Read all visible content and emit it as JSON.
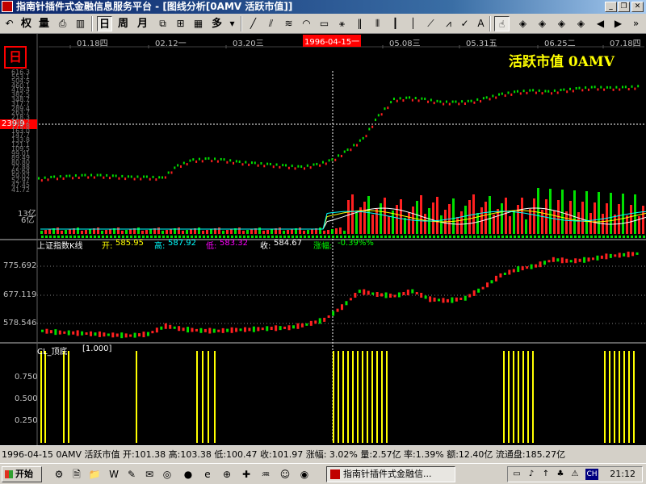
{
  "window": {
    "title": "指南针插件式金融信息服务平台 - [图线分析[0AMV 活跃市值]]",
    "minimize": "_",
    "restore": "❐",
    "close": "✕"
  },
  "toolbar": {
    "day_label": "日",
    "week_label": "周",
    "month_label": "月",
    "multi_label": "多",
    "quan_label": "权",
    "liang_label": "量"
  },
  "chart": {
    "date_labels": [
      "01.18四",
      "02.12一",
      "03.20三",
      "05.08三",
      "05.31五",
      "06.25二",
      "07.18四"
    ],
    "cursor_date": "1996-04-15一",
    "logo_glyph": "日",
    "big_title": "活跃市值 0AMV",
    "current_price": "239.9",
    "price_axis": [
      "616.3",
      "553.1",
      "504.5",
      "460.1",
      "419.4",
      "382.5",
      "348.7",
      "317.7",
      "289.4",
      "263.7",
      "218.3",
      "198.2",
      "179.8",
      "163.0",
      "147.7",
      "133.8",
      "121.1",
      "109.5",
      "99.01",
      "89.49",
      "80.80",
      "72.88",
      "65.64",
      "59.02",
      "52.97",
      "47.45",
      "41.72"
    ],
    "volume_axis": [
      "13亿",
      "6亿"
    ],
    "index_panel": {
      "name": "上证指数K线",
      "open_label": "开:",
      "open": "585.95",
      "high_label": "高:",
      "high": "587.92",
      "low_label": "低:",
      "low": "583.32",
      "close_label": "收:",
      "close": "584.67",
      "change_label": "涨幅:",
      "change": "-0.39%%",
      "axis": [
        "775.692",
        "677.119",
        "578.546"
      ]
    },
    "indicator_panel": {
      "name": "CL_顶底",
      "value": "[1.000]",
      "axis": [
        "0.750",
        "0.500",
        "0.250"
      ]
    },
    "colors": {
      "up": "#ff2020",
      "down": "#00e000",
      "ma1": "#ffffff",
      "ma2": "#ffff00",
      "ma3": "#00ffff",
      "signal": "#ffff00"
    }
  },
  "chart_data": [
    {
      "type": "line",
      "title": "活跃市值 0AMV",
      "y_scale": "log",
      "ylim": [
        41.72,
        616.3
      ],
      "x_ticks": [
        "01.18四",
        "02.12一",
        "03.20三",
        "05.08三",
        "05.31五",
        "06.25二",
        "07.18四"
      ],
      "series": [
        {
          "name": "0AMV",
          "values": [
            52,
            54,
            55,
            56,
            56,
            55,
            54,
            54,
            53,
            70,
            80,
            82,
            80,
            76,
            74,
            72,
            70,
            68,
            72,
            80,
            100,
            130,
            220,
            320,
            330,
            320,
            300,
            300,
            305,
            330,
            360,
            380,
            390,
            380,
            395,
            410,
            420,
            415,
            420,
            430
          ]
        }
      ]
    },
    {
      "type": "bar",
      "title": "上证指数K线",
      "ylim": [
        540,
        820
      ],
      "series": [
        {
          "name": "上证指数",
          "values": [
            565,
            560,
            558,
            555,
            552,
            550,
            555,
            580,
            570,
            566,
            565,
            568,
            570,
            573,
            575,
            585,
            600,
            640,
            690,
            680,
            675,
            690,
            665,
            660,
            668,
            700,
            740,
            760,
            770,
            790,
            785,
            790,
            800,
            805,
            810
          ]
        }
      ]
    },
    {
      "type": "bar",
      "title": "CL_顶底",
      "ylim": [
        0,
        1
      ],
      "series": [
        {
          "name": "CL_顶底",
          "values": [
            1,
            1,
            1,
            1,
            1,
            1,
            1,
            1,
            1,
            1,
            1,
            1,
            1,
            1,
            1,
            1,
            1,
            1,
            1,
            1,
            1,
            1,
            1,
            1,
            1,
            1,
            1,
            1,
            1,
            1,
            1,
            1,
            1,
            1,
            1,
            1,
            1,
            1,
            1,
            1
          ]
        }
      ]
    }
  ],
  "status": {
    "text": "1996-04-15  0AMV  活跃市值  开:101.38  高:103.38  低:100.47  收:101.97  涨幅: 3.02%  量:2.57亿  率:1.39%  额:12.40亿  流通盘:185.27亿"
  },
  "taskbar": {
    "start_label": "开始",
    "task_label": "指南针插件式金融信...",
    "ime_label": "CH",
    "clock": "21:12"
  }
}
